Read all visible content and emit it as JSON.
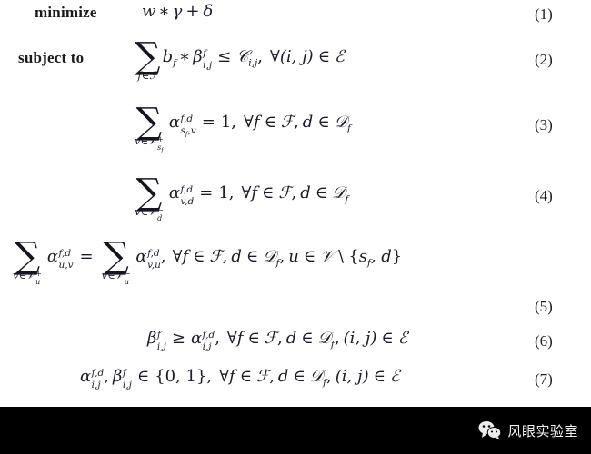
{
  "document": {
    "type": "optimization-formulation",
    "background_color": "#ffffff",
    "text_color": "#1c1c28"
  },
  "formulation": {
    "objective_keyword": "minimize",
    "constraints_keyword": "subject to",
    "equations": [
      {
        "number": "(1)",
        "label": "objective-function",
        "expression": "w * γ + δ",
        "parts": {
          "var_w": "w",
          "operator_times": "∗",
          "var_gamma": "γ",
          "operator_plus": "+",
          "var_delta": "δ"
        }
      },
      {
        "number": "(2)",
        "label": "link-capacity-constraint",
        "expression": "∑_{f∈ℱ} b_f * β^f_{i,j} ≤ 𝒞_{i,j}, ∀(i,j) ∈ ℰ",
        "parts": {
          "sum_limit": "f∈ℱ",
          "coefficient": "b",
          "coefficient_sub": "f",
          "operator_times": "∗",
          "beta": "β",
          "beta_sup": "f",
          "beta_sub": "i,j",
          "relation": "≤",
          "capacity": "𝒞",
          "capacity_sub": "i,j",
          "forall": "∀",
          "domain": "(i, j)",
          "in": "∈",
          "set": "ℰ"
        }
      },
      {
        "number": "(3)",
        "label": "source-outflow-constraint",
        "expression": "∑_{v∈𝒱⁺_{s_f}} α^{f,d}_{s_f,v} = 1, ∀f ∈ ℱ, d ∈ 𝒟_f",
        "parts": {
          "sum_limit_v": "v",
          "sum_limit_in": "∈",
          "sum_limit_set": "𝒱",
          "sum_limit_sup": "+",
          "sum_limit_sub": "s",
          "sum_limit_subsub": "f",
          "alpha": "α",
          "alpha_sup": "f,d",
          "alpha_sub": "s",
          "alpha_subsub": "f",
          "alpha_sub_tail": ",v",
          "relation": "=",
          "value": "1",
          "forall": "∀",
          "flow": "f",
          "in": "∈",
          "flow_set": "ℱ",
          "dest": "d",
          "dest_set": "𝒟",
          "dest_set_sub": "f"
        }
      },
      {
        "number": "(4)",
        "label": "destination-inflow-constraint",
        "expression": "∑_{v∈𝒱⁻_d} α^{f,d}_{v,d} = 1, ∀f ∈ ℱ, d ∈ 𝒟_f",
        "parts": {
          "sum_limit_v": "v",
          "sum_limit_in": "∈",
          "sum_limit_set": "𝒱",
          "sum_limit_sup": "−",
          "sum_limit_sub": "d",
          "alpha": "α",
          "alpha_sup": "f,d",
          "alpha_sub": "v,d",
          "relation": "=",
          "value": "1",
          "forall": "∀",
          "flow": "f",
          "in": "∈",
          "flow_set": "ℱ",
          "dest": "d",
          "dest_set": "𝒟",
          "dest_set_sub": "f"
        }
      },
      {
        "number": "(5)",
        "label": "flow-conservation-constraint",
        "expression": "∑_{v∈𝒱⁺_u} α^{f,d}_{u,v} = ∑_{v∈𝒱⁻_u} α^{f,d}_{v,u}, ∀f ∈ ℱ, d ∈ 𝒟_f, u ∈ 𝒱 \\ {s_f, d}",
        "parts": {
          "lhs_sum_limit_v": "v",
          "lhs_sum_limit_in": "∈",
          "lhs_sum_limit_set": "𝒱",
          "lhs_sum_limit_sup": "+",
          "lhs_sum_limit_sub": "u",
          "lhs_alpha": "α",
          "lhs_alpha_sup": "f,d",
          "lhs_alpha_sub": "u,v",
          "relation": "=",
          "rhs_sum_limit_v": "v",
          "rhs_sum_limit_in": "∈",
          "rhs_sum_limit_set": "𝒱",
          "rhs_sum_limit_sup": "−",
          "rhs_sum_limit_sub": "u",
          "rhs_alpha": "α",
          "rhs_alpha_sup": "f,d",
          "rhs_alpha_sub": "v,u",
          "forall": "∀",
          "flow": "f",
          "in": "∈",
          "flow_set": "ℱ",
          "dest": "d",
          "dest_set": "𝒟",
          "dest_set_sub": "f",
          "node": "u",
          "node_set": "𝒱",
          "setminus": "\\",
          "excluded_open": "{",
          "excluded_s": "s",
          "excluded_s_sub": "f",
          "excluded_d": ", d",
          "excluded_close": "}"
        }
      },
      {
        "number": "(6)",
        "label": "link-usage-indicator-constraint",
        "expression": "β^f_{i,j} ≥ α^{f,d}_{i,j}, ∀f ∈ ℱ, d ∈ 𝒟_f, (i,j) ∈ ℰ",
        "parts": {
          "beta": "β",
          "beta_sup": "f",
          "beta_sub": "i,j",
          "relation": "≥",
          "alpha": "α",
          "alpha_sup": "f,d",
          "alpha_sub": "i,j",
          "forall": "∀",
          "flow": "f",
          "in": "∈",
          "flow_set": "ℱ",
          "dest": "d",
          "dest_set": "𝒟",
          "dest_set_sub": "f",
          "edge": "(i, j)",
          "edge_set": "ℰ"
        }
      },
      {
        "number": "(7)",
        "label": "binary-domain-constraint",
        "expression": "α^{f,d}_{i,j}, β^f_{i,j} ∈ {0,1}, ∀f ∈ ℱ, d ∈ 𝒟_f, (i,j) ∈ ℰ",
        "parts": {
          "alpha": "α",
          "alpha_sup": "f,d",
          "alpha_sub": "i,j",
          "comma": ",",
          "beta": "β",
          "beta_sup": "f",
          "beta_sub": "i,j",
          "in": "∈",
          "domain_set": "{0, 1}",
          "forall": "∀",
          "flow": "f",
          "flow_set": "ℱ",
          "dest": "d",
          "dest_set": "𝒟",
          "dest_set_sub": "f",
          "edge": "(i, j)",
          "edge_set": "ℰ"
        }
      }
    ]
  },
  "footer": {
    "background_color": "#000000",
    "icon_name": "wechat-icon",
    "icon_color": "#ededed",
    "brand_text": "风眼实验室",
    "text_color": "#f2f2f2"
  }
}
